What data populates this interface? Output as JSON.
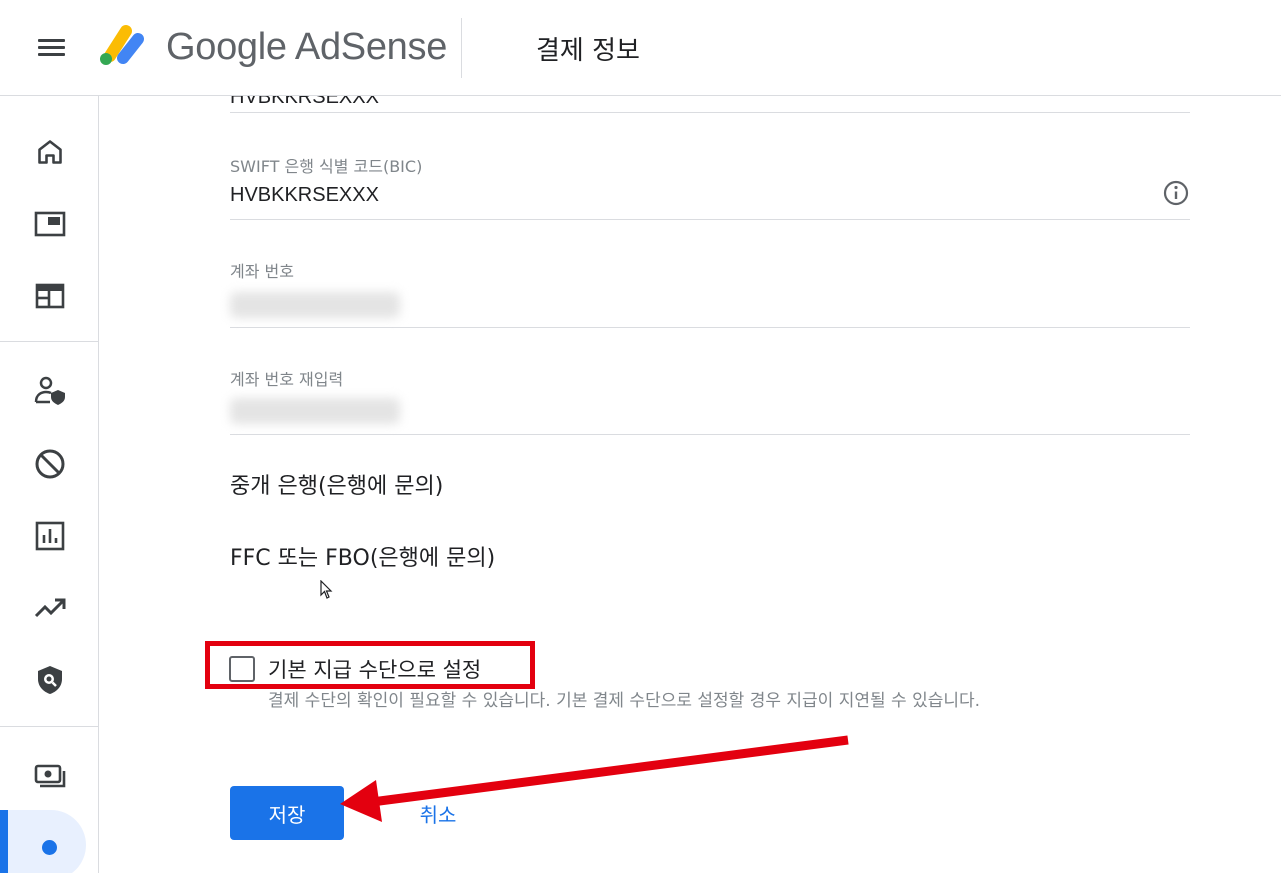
{
  "header": {
    "menu_icon": "menu-icon",
    "brand": "Google AdSense",
    "page_title": "결제 정보"
  },
  "sidebar": {
    "items": [
      {
        "icon": "home-icon"
      },
      {
        "icon": "sites-icon"
      },
      {
        "icon": "ads-icon"
      },
      {
        "icon": "privacy-messaging-icon"
      },
      {
        "icon": "blocking-controls-icon"
      },
      {
        "icon": "reports-icon"
      },
      {
        "icon": "optimization-icon"
      },
      {
        "icon": "policy-center-icon"
      },
      {
        "icon": "payments-icon"
      },
      {
        "icon": "account-icon"
      }
    ]
  },
  "form": {
    "prev_value_partial": "HVBKKRSEXXX",
    "swift_label": "SWIFT 은행 식별 코드(BIC)",
    "swift_value": "HVBKKRSEXXX",
    "account_label": "계좌 번호",
    "account_reenter_label": "계좌 번호 재입력",
    "intermediary_bank_label": "중개 은행(은행에 문의)",
    "ffc_label": "FFC 또는 FBO(은행에 문의)",
    "default_payment_label": "기본 지급 수단으로 설정",
    "default_payment_checked": false,
    "hint": "결제 수단의 확인이 필요할 수 있습니다. 기본 결제 수단으로 설정할 경우 지급이 지연될 수 있습니다.",
    "save_label": "저장",
    "cancel_label": "취소"
  },
  "annotations": {
    "highlight_color": "#e3000f",
    "arrow_color": "#e3000f"
  },
  "colors": {
    "primary": "#1a73e8",
    "text": "#202124",
    "secondary_text": "#80868b",
    "divider": "#dadce0"
  }
}
